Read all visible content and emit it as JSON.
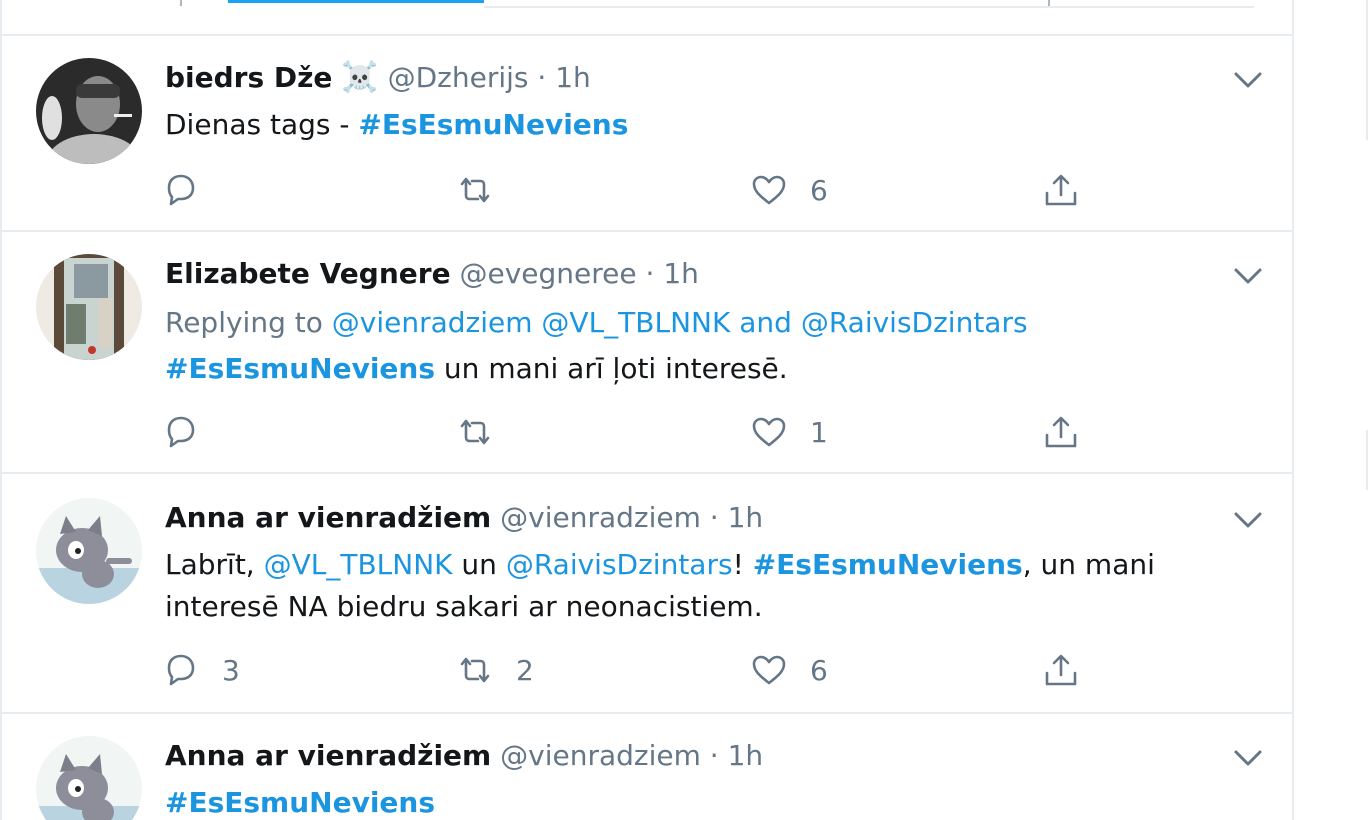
{
  "tweets": [
    {
      "name": "biedrs Dže",
      "name_emoji": "☠️",
      "handle": "@Dzherijs",
      "time": "1h",
      "text": [
        "Dienas tags - ",
        "#EsEsmuNeviens"
      ],
      "counts": {
        "reply": "",
        "retweet": "",
        "like": "6"
      }
    },
    {
      "name": "Elizabete Vegnere",
      "handle": "@evegneree",
      "time": "1h",
      "replying_prefix": "Replying to ",
      "replying_users": [
        "@vienradziem",
        "@VL_TBLNNK"
      ],
      "replying_and": " and ",
      "replying_last": "@RaivisDzintars",
      "text": [
        "#EsEsmuNeviens",
        " un mani arī ļoti interesē."
      ],
      "counts": {
        "reply": "",
        "retweet": "",
        "like": "1"
      }
    },
    {
      "name": "Anna ar vienradžiem",
      "handle": "@vienradziem",
      "time": "1h",
      "text": [
        "Labrīt, ",
        "@VL_TBLNNK",
        " un ",
        "@RaivisDzintars",
        "! ",
        "#EsEsmuNeviens",
        ", un mani interesē NA biedru sakari ar neonacistiem."
      ],
      "counts": {
        "reply": "3",
        "retweet": "2",
        "like": "6"
      }
    },
    {
      "name": "Anna ar vienradžiem",
      "handle": "@vienradziem",
      "time": "1h",
      "text": [
        "#EsEsmuNeviens"
      ]
    }
  ],
  "separator": " · ",
  "icons": [
    "reply-icon",
    "retweet-icon",
    "like-icon",
    "share-icon",
    "chevron-down-icon"
  ],
  "colors": {
    "link": "#1b95e0",
    "muted": "#657786",
    "border": "#e6ecf0"
  }
}
